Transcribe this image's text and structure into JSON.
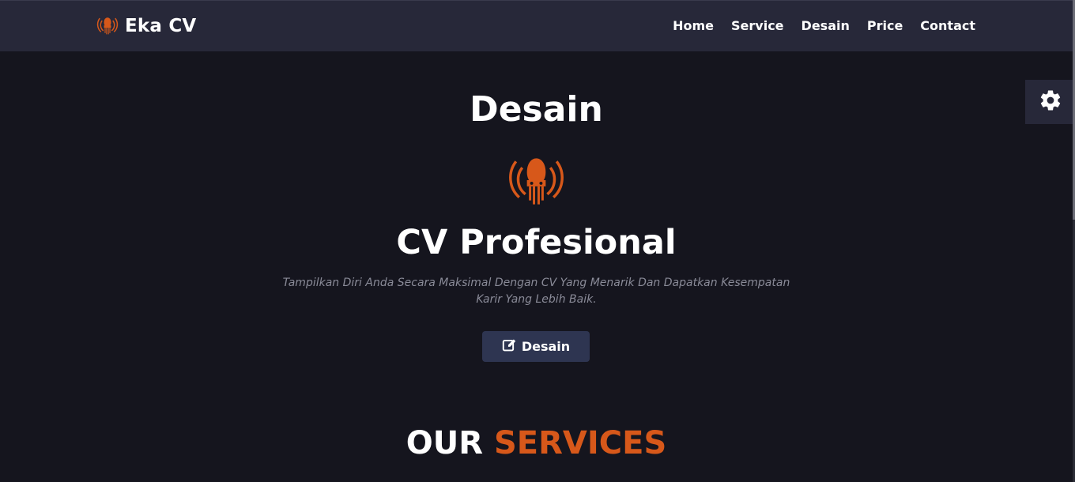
{
  "brand": {
    "name": "Eka CV",
    "logo_icon": "octopus-logo-icon"
  },
  "nav": {
    "items": [
      {
        "label": "Home"
      },
      {
        "label": "Service"
      },
      {
        "label": "Desain"
      },
      {
        "label": "Price"
      },
      {
        "label": "Contact"
      }
    ]
  },
  "settings": {
    "icon": "gear-icon"
  },
  "hero": {
    "heading": "Desain",
    "logo_icon": "octopus-logo-icon",
    "title": "CV Profesional",
    "description": "Tampilkan Diri Anda Secara Maksimal Dengan CV Yang Menarik Dan Dapatkan Kesempatan Karir Yang Lebih Baik.",
    "button_label": "Desain",
    "button_icon": "edit-icon"
  },
  "services": {
    "heading_main": "OUR",
    "heading_accent": "SERVICES"
  },
  "colors": {
    "background": "#15151e",
    "navbar": "#272839",
    "accent": "#d7581a",
    "button": "#2e3551",
    "muted_text": "#8a8b98"
  }
}
